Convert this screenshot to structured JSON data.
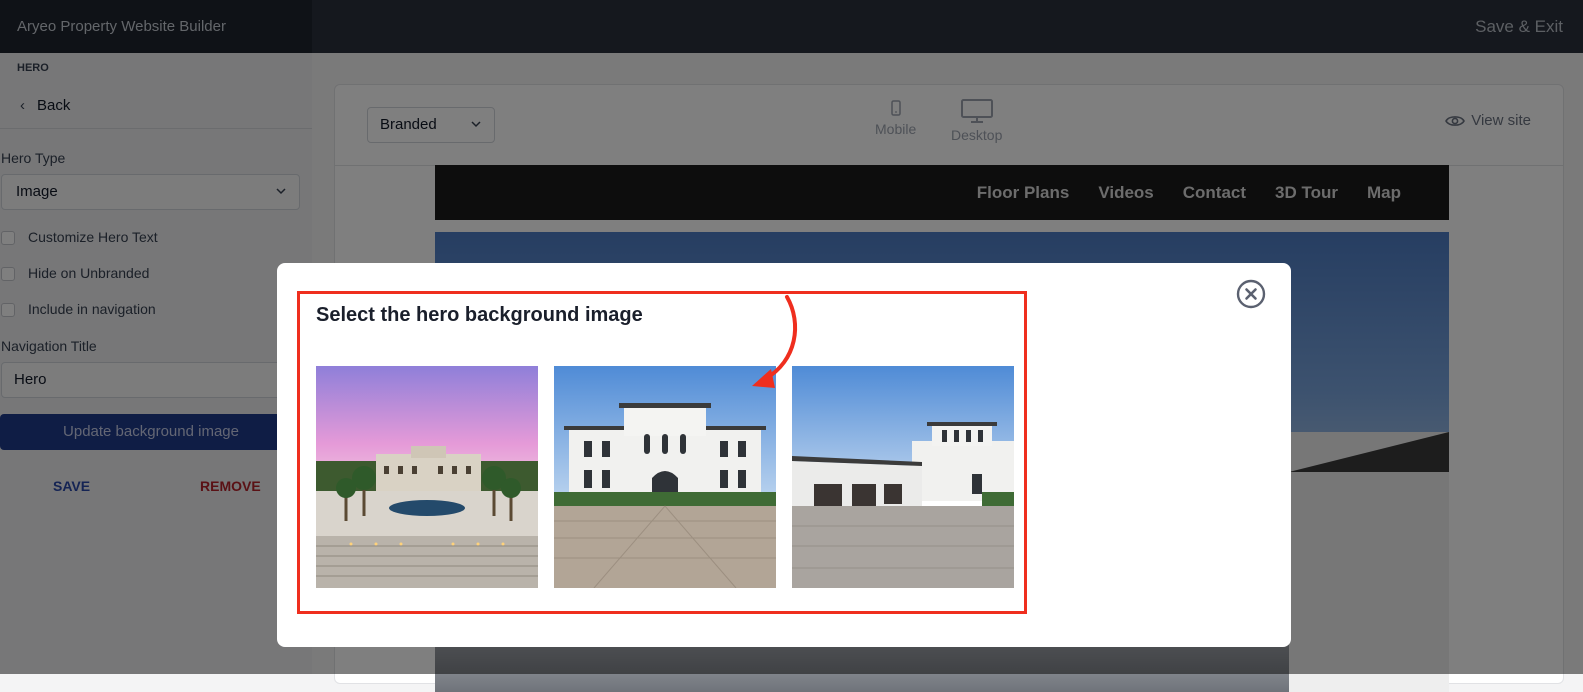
{
  "topbar": {
    "brand": "Aryeo Property Website Builder",
    "save_exit": "Save & Exit"
  },
  "sidebar": {
    "section": "HERO",
    "back": "Back",
    "hero_type_label": "Hero Type",
    "hero_type_value": "Image",
    "checkboxes": [
      {
        "label": "Customize Hero Text",
        "checked": false
      },
      {
        "label": "Hide on Unbranded",
        "checked": false
      },
      {
        "label": "Include in navigation",
        "checked": false
      }
    ],
    "nav_title_label": "Navigation Title",
    "nav_title_value": "Hero",
    "update_bg": "Update background image",
    "save": "SAVE",
    "remove": "REMOVE"
  },
  "preview": {
    "mode": "Branded",
    "devices": {
      "mobile": "Mobile",
      "desktop": "Desktop"
    },
    "view_site": "View site",
    "nav_links": [
      "Floor Plans",
      "Videos",
      "Contact",
      "3D Tour",
      "Map"
    ]
  },
  "modal": {
    "title": "Select the hero background image",
    "images": [
      {
        "name": "thumb-mansion-sunset",
        "sky": "#c9a0d8"
      },
      {
        "name": "thumb-white-villa-front",
        "sky": "#5e94d8"
      },
      {
        "name": "thumb-villa-garage-side",
        "sky": "#5e94d8"
      }
    ],
    "highlight_color": "#ef2e1e"
  }
}
